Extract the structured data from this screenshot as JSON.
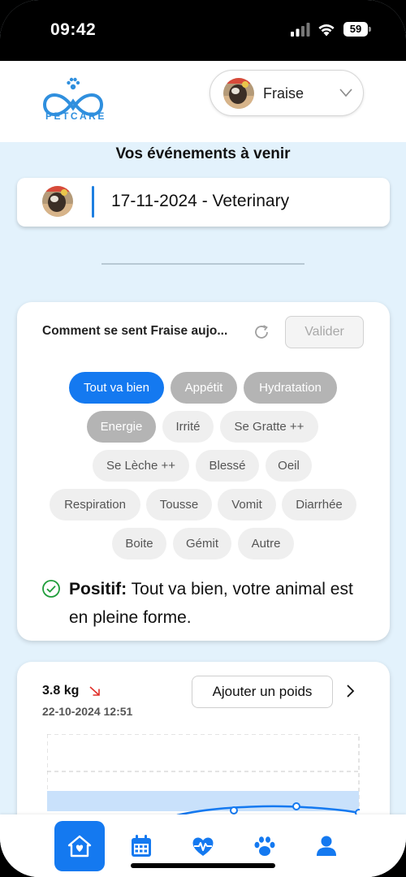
{
  "status_bar": {
    "time": "09:42",
    "battery": "59"
  },
  "header": {
    "logo_text": "PETCARE",
    "pet_selector": {
      "selected": "Fraise",
      "icon": "chevron-down-icon"
    }
  },
  "events": {
    "title": "Vos événements à venir",
    "items": [
      {
        "text": "17-11-2024 - Veterinary"
      }
    ]
  },
  "mood": {
    "question": "Comment se sent Fraise aujo...",
    "validate_label": "Valider",
    "chips": [
      {
        "label": "Tout va bien",
        "state": "primary"
      },
      {
        "label": "Appétit",
        "state": "selected"
      },
      {
        "label": "Hydratation",
        "state": "selected"
      },
      {
        "label": "Energie",
        "state": "selected"
      },
      {
        "label": "Irrité",
        "state": "default"
      },
      {
        "label": "Se Gratte ++",
        "state": "default"
      },
      {
        "label": "Se Lèche ++",
        "state": "default"
      },
      {
        "label": "Blessé",
        "state": "default"
      },
      {
        "label": "Oeil",
        "state": "default"
      },
      {
        "label": "Respiration",
        "state": "default"
      },
      {
        "label": "Tousse",
        "state": "default"
      },
      {
        "label": "Vomit",
        "state": "default"
      },
      {
        "label": "Diarrhée",
        "state": "default"
      },
      {
        "label": "Boite",
        "state": "default"
      },
      {
        "label": "Gémit",
        "state": "default"
      },
      {
        "label": "Autre",
        "state": "default"
      }
    ],
    "result_label": "Positif:",
    "result_text": "Tout va bien, votre animal est en pleine forme."
  },
  "weight": {
    "value": "3.8 kg",
    "trend": "down",
    "date": "22-10-2024 12:51",
    "add_label": "Ajouter un poids"
  },
  "tabbar": {
    "items": [
      {
        "name": "home",
        "icon": "home-heart-icon",
        "active": true
      },
      {
        "name": "calendar",
        "icon": "calendar-icon",
        "active": false
      },
      {
        "name": "health",
        "icon": "heartbeat-icon",
        "active": false
      },
      {
        "name": "pets",
        "icon": "paw-icon",
        "active": false
      },
      {
        "name": "profile",
        "icon": "user-icon",
        "active": false
      }
    ]
  },
  "colors": {
    "accent": "#1479f0",
    "background": "#e3f2fc",
    "positive": "#1f9d3a",
    "trend_down": "#e0302a"
  }
}
